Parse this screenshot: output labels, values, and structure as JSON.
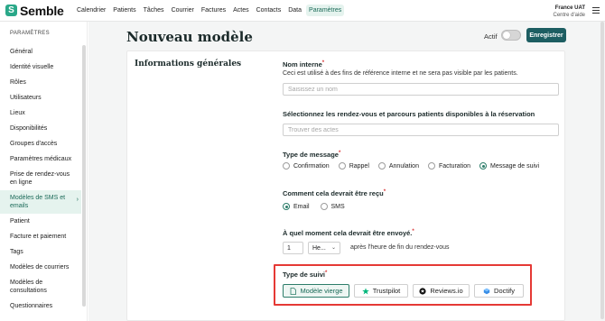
{
  "header": {
    "brand": "Semble",
    "nav": [
      {
        "label": "Calendrier",
        "active": false
      },
      {
        "label": "Patients",
        "active": false
      },
      {
        "label": "Tâches",
        "active": false
      },
      {
        "label": "Courrier",
        "active": false
      },
      {
        "label": "Factures",
        "active": false
      },
      {
        "label": "Actes",
        "active": false
      },
      {
        "label": "Contacts",
        "active": false
      },
      {
        "label": "Data",
        "active": false
      },
      {
        "label": "Paramètres",
        "active": true
      }
    ],
    "account": {
      "name": "France UAT",
      "subtitle": "Centre d'aide"
    },
    "menu_icon": "hamburger-menu-icon"
  },
  "sidebar": {
    "heading": "PARAMÈTRES",
    "items": [
      {
        "label": "Général"
      },
      {
        "label": "Identité visuelle"
      },
      {
        "label": "Rôles"
      },
      {
        "label": "Utilisateurs"
      },
      {
        "label": "Lieux"
      },
      {
        "label": "Disponibilités"
      },
      {
        "label": "Groupes d'accès"
      },
      {
        "label": "Paramètres médicaux"
      },
      {
        "label": "Prise de rendez-vous en ligne"
      },
      {
        "label": "Modèles de SMS et emails",
        "active": true,
        "chevron": "›"
      },
      {
        "label": "Patient"
      },
      {
        "label": "Facture et paiement"
      },
      {
        "label": "Tags"
      },
      {
        "label": "Modèles de courriers"
      },
      {
        "label": "Modèles de consultations"
      },
      {
        "label": "Questionnaires"
      }
    ]
  },
  "page": {
    "title": "Nouveau modèle",
    "active_label": "Actif",
    "active_on": false,
    "save_label": "Enregistrer"
  },
  "form": {
    "section_title": "Informations générales",
    "internal_name": {
      "label": "Nom interne",
      "help": "Ceci est utilisé à des fins de référence interne et ne sera pas visible par les patients.",
      "placeholder": "Saisissez un nom",
      "value": ""
    },
    "appointments": {
      "label": "Sélectionnez les rendez-vous et parcours patients disponibles à la réservation",
      "placeholder": "Trouver des actes"
    },
    "message_type": {
      "label": "Type de message",
      "options": [
        {
          "label": "Confirmation",
          "checked": false
        },
        {
          "label": "Rappel",
          "checked": false
        },
        {
          "label": "Annulation",
          "checked": false
        },
        {
          "label": "Facturation",
          "checked": false
        },
        {
          "label": "Message de suivi",
          "checked": true
        }
      ]
    },
    "delivery": {
      "label": "Comment cela devrait être reçu",
      "options": [
        {
          "label": "Email",
          "checked": true
        },
        {
          "label": "SMS",
          "checked": false
        }
      ]
    },
    "timing": {
      "label": "À quel moment cela devrait être envoyé.",
      "amount": "1",
      "unit": "He...",
      "after_text": "après l'heure de fin du rendez-vous"
    },
    "follow_up": {
      "label": "Type de suivi",
      "buttons": [
        {
          "label": "Modèle vierge",
          "icon": "blank-document-icon",
          "selected": true
        },
        {
          "label": "Trustpilot",
          "icon": "trustpilot-star-icon",
          "selected": false
        },
        {
          "label": "Reviews.io",
          "icon": "reviews-io-icon",
          "selected": false
        },
        {
          "label": "Doctify",
          "icon": "doctify-icon",
          "selected": false
        }
      ]
    }
  },
  "colors": {
    "brand": "#2aa889",
    "primary_button": "#1d5e62",
    "active_nav_bg": "#e5f3ee",
    "highlight_border": "#e53935",
    "required_star": "#d93636"
  }
}
